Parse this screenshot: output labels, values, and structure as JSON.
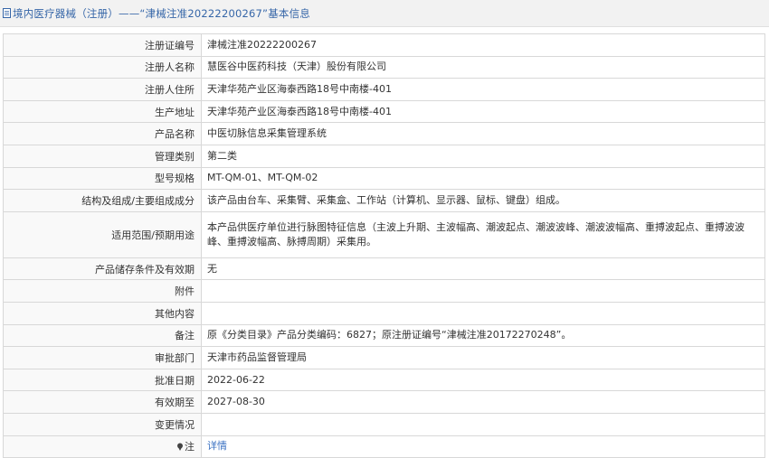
{
  "header": {
    "title": "境内医疗器械（注册）——“津械注准20222200267”基本信息"
  },
  "rows": [
    {
      "label": "注册证编号",
      "value": "津械注准20222200267"
    },
    {
      "label": "注册人名称",
      "value": "慧医谷中医药科技（天津）股份有限公司"
    },
    {
      "label": "注册人住所",
      "value": "天津华苑产业区海泰西路18号中南楼-401"
    },
    {
      "label": "生产地址",
      "value": "天津华苑产业区海泰西路18号中南楼-401"
    },
    {
      "label": "产品名称",
      "value": "中医切脉信息采集管理系统"
    },
    {
      "label": "管理类别",
      "value": "第二类"
    },
    {
      "label": "型号规格",
      "value": "MT-QM-01、MT-QM-02"
    },
    {
      "label": "结构及组成/主要组成成分",
      "value": "该产品由台车、采集臂、采集盒、工作站（计算机、显示器、鼠标、键盘）组成。"
    },
    {
      "label": "适用范围/预期用途",
      "value": "本产品供医疗单位进行脉图特征信息（主波上升期、主波幅高、潮波起点、潮波波峰、潮波波幅高、重搏波起点、重搏波波峰、重搏波幅高、脉搏周期）采集用。"
    },
    {
      "label": "产品储存条件及有效期",
      "value": "无"
    },
    {
      "label": "附件",
      "value": ""
    },
    {
      "label": "其他内容",
      "value": ""
    },
    {
      "label": "备注",
      "value": "原《分类目录》产品分类编码：6827；原注册证编号“津械注准20172270248”。"
    },
    {
      "label": "审批部门",
      "value": "天津市药品监督管理局"
    },
    {
      "label": "批准日期",
      "value": "2022-06-22"
    },
    {
      "label": "有效期至",
      "value": "2027-08-30"
    },
    {
      "label": "变更情况",
      "value": ""
    },
    {
      "label": "注",
      "value": "详情"
    }
  ]
}
